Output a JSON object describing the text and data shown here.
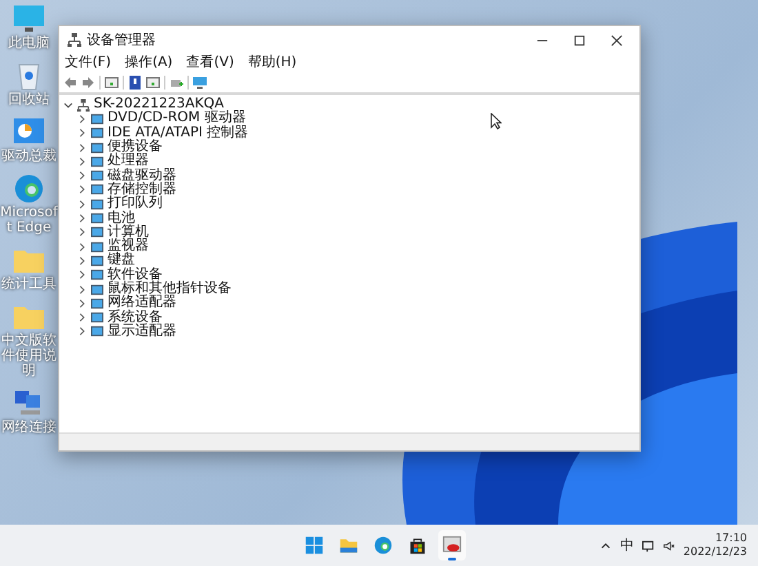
{
  "desktop_icons": [
    {
      "label": "此电脑",
      "kind": "monitor"
    },
    {
      "label": "回收站",
      "kind": "bin"
    },
    {
      "label": "驱动总裁",
      "kind": "chart"
    },
    {
      "label": "Microsoft Edge",
      "kind": "edge"
    },
    {
      "label": "统计工具",
      "kind": "folder"
    },
    {
      "label": "中文版软件使用说明",
      "kind": "folder"
    },
    {
      "label": "网络连接",
      "kind": "network"
    }
  ],
  "window": {
    "title": "设备管理器",
    "menu": [
      "文件(F)",
      "操作(A)",
      "查看(V)",
      "帮助(H)"
    ],
    "tree": {
      "label": "SK-20221223AKQA",
      "expanded": true,
      "children": [
        {
          "label": "DVD/CD-ROM 驱动器",
          "expanded": false
        },
        {
          "label": "IDE ATA/ATAPI 控制器",
          "expanded": false
        },
        {
          "label": "便携设备",
          "expanded": false
        },
        {
          "label": "处理器",
          "expanded": false
        },
        {
          "label": "磁盘驱动器",
          "expanded": false
        },
        {
          "label": "存储控制器",
          "expanded": false
        },
        {
          "label": "打印队列",
          "expanded": false
        },
        {
          "label": "电池",
          "expanded": false
        },
        {
          "label": "计算机",
          "expanded": false
        },
        {
          "label": "监视器",
          "expanded": false
        },
        {
          "label": "键盘",
          "expanded": false
        },
        {
          "label": "软件设备",
          "expanded": false
        },
        {
          "label": "鼠标和其他指针设备",
          "expanded": false
        },
        {
          "label": "网络适配器",
          "expanded": false
        },
        {
          "label": "系统设备",
          "expanded": false
        },
        {
          "label": "显示适配器",
          "expanded": false
        }
      ]
    }
  },
  "taskbar": {
    "apps": [
      {
        "kind": "start",
        "selected": false
      },
      {
        "kind": "explorer",
        "selected": false
      },
      {
        "kind": "edge",
        "selected": false
      },
      {
        "kind": "store",
        "selected": false
      },
      {
        "kind": "devmgr",
        "selected": true
      }
    ],
    "ime": "中",
    "time": "17:10",
    "date": "2022/12/23"
  }
}
